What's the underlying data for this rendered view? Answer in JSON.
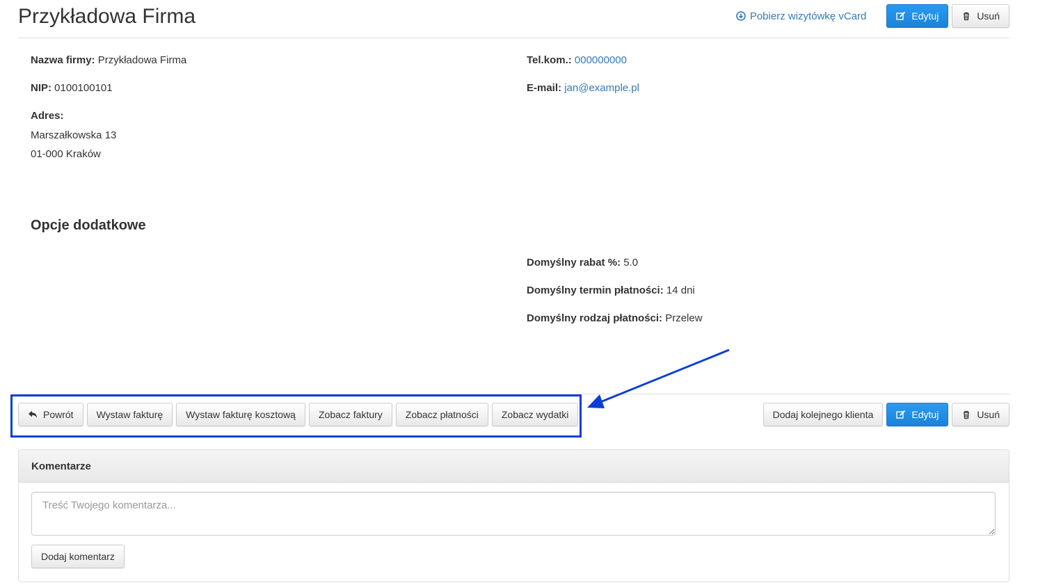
{
  "header": {
    "title": "Przykładowa Firma",
    "vcard_link": "Pobierz wizytówkę vCard",
    "edit_label": "Edytuj",
    "delete_label": "Usuń"
  },
  "details": {
    "company_name_label": "Nazwa firmy:",
    "company_name": "Przykładowa Firma",
    "nip_label": "NIP:",
    "nip": "0100100101",
    "address_label": "Adres:",
    "address_line1": "Marszałkowska 13",
    "address_line2": "01-000 Kraków",
    "phone_label": "Tel.kom.:",
    "phone": "000000000",
    "email_label": "E-mail:",
    "email": "jan@example.pl"
  },
  "extra_options": {
    "title": "Opcje dodatkowe",
    "discount_label": "Domyślny rabat %:",
    "discount": "5.0",
    "payment_term_label": "Domyślny termin płatności:",
    "payment_term": "14 dni",
    "payment_type_label": "Domyślny rodzaj płatności:",
    "payment_type": "Przelew"
  },
  "toolbar": {
    "back": "Powrót",
    "issue_invoice": "Wystaw fakturę",
    "issue_cost_invoice": "Wystaw fakturę kosztową",
    "view_invoices": "Zobacz faktury",
    "view_payments": "Zobacz płatności",
    "view_expenses": "Zobacz wydatki",
    "add_client": "Dodaj kolejnego klienta",
    "edit": "Edytuj",
    "delete": "Usuń"
  },
  "comments": {
    "title": "Komentarze",
    "placeholder": "Treść Twojego komentarza...",
    "value": "",
    "submit": "Dodaj komentarz"
  },
  "colors": {
    "primary": "#1a82da",
    "link": "#337ab7",
    "annotation": "#0a3fd6"
  }
}
